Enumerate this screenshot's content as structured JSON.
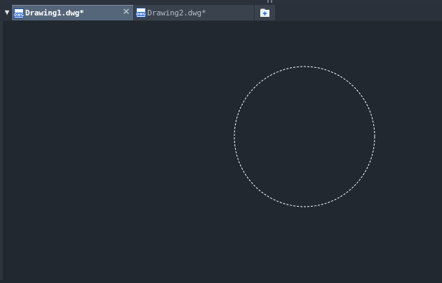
{
  "tabs": [
    {
      "label": "Drawing1.dwg*",
      "active": true,
      "icon": "dwg-file-icon",
      "closable": true
    },
    {
      "label": "Drawing2.dwg*",
      "active": false,
      "icon": "dwg-file-icon",
      "closable": false
    }
  ],
  "icons": {
    "menu": "triangle-down-icon",
    "close": "close-icon",
    "new_tab": "new-tab-icon",
    "dwg_text": "DWG"
  },
  "close_glyph": "✕",
  "menu_glyph": "▼",
  "canvas": {
    "background": "#212830",
    "entity": {
      "type": "circle",
      "style": "dashed",
      "color": "#ffffff",
      "selected": true
    }
  }
}
